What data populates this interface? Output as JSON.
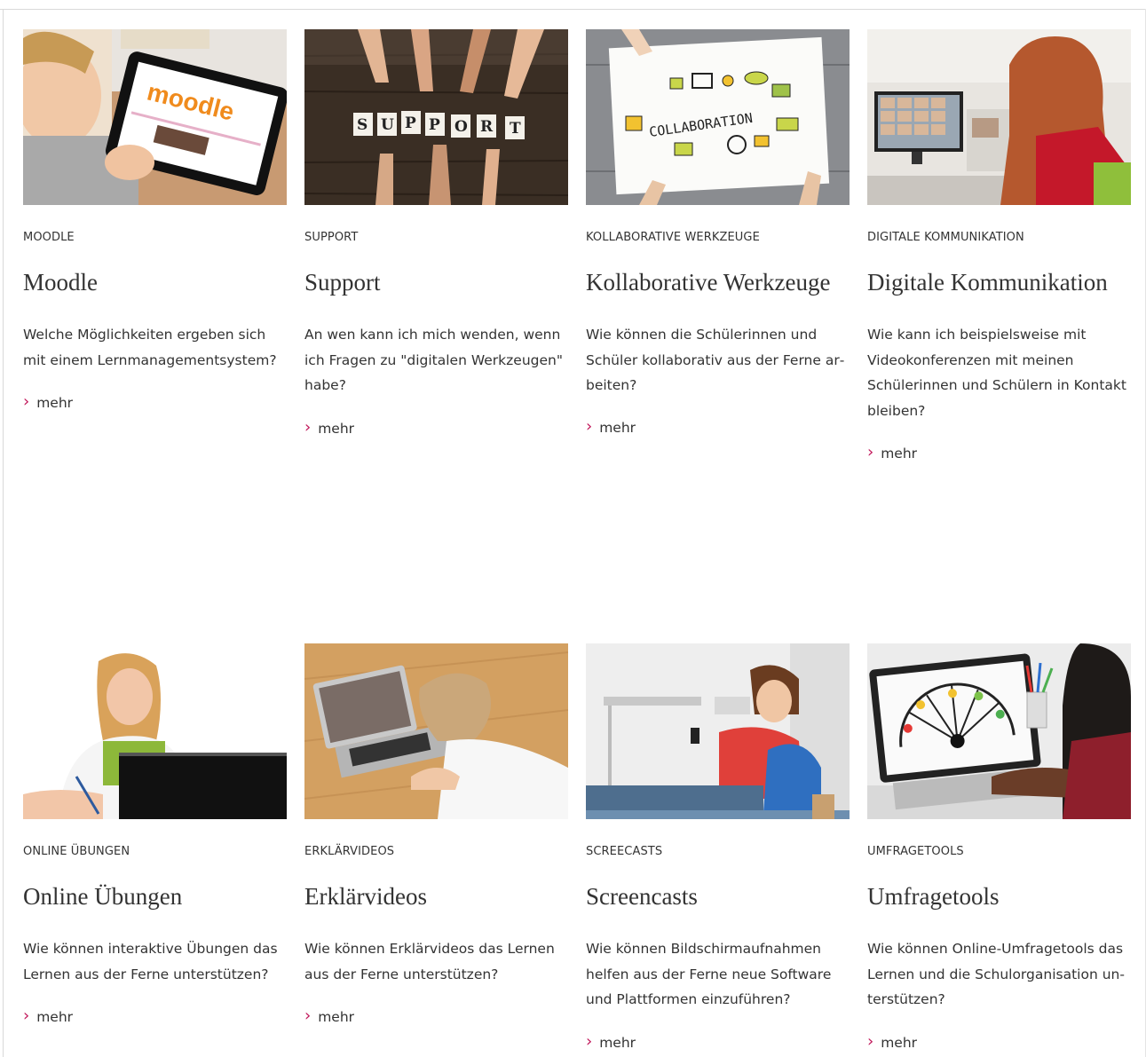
{
  "cards": [
    {
      "category": "MOODLE",
      "title": "Moodle",
      "description": "Welche Möglichkeiten ergeben sich mit einem Lernmanagementsystem?",
      "more": "mehr",
      "image_text": "moodle"
    },
    {
      "category": "SUPPORT",
      "title": "Support",
      "description": "An wen kann ich mich wenden, wenn ich Fragen zu \"digitalen Werkzeugen\" habe?",
      "more": "mehr",
      "image_text": "SUPPORT"
    },
    {
      "category": "KOLLABORATIVE WERKZEUGE",
      "title": "Kollaborative Werkzeuge",
      "description": "Wie können die Schülerinnen und Schüler kollaborativ aus der Ferne ar­beiten?",
      "more": "mehr",
      "image_text": "COLLABORATION"
    },
    {
      "category": "DIGITALE KOMMUNIKATION",
      "title": "Digitale Kommunikation",
      "description": "Wie kann ich beispielsweise mit Videokonferenzen mit meinen Schülerinnen und Schülern in Kontakt bleiben?",
      "more": "mehr"
    },
    {
      "category": "ONLINE ÜBUNGEN",
      "title": "Online Übungen",
      "description": "Wie können interaktive Übungen das Lernen aus der Ferne unterstützen?",
      "more": "mehr"
    },
    {
      "category": "ERKLÄRVIDEOS",
      "title": "Erklärvideos",
      "description": "Wie können Erklärvideos das Lernen aus der Ferne unterstützen?",
      "more": "mehr"
    },
    {
      "category": "SCREECASTS",
      "title": "Screencasts",
      "description": "Wie können Bildschirmaufnahmen helfen aus der Ferne neue Software und Plattformen einzuführen?",
      "more": "mehr"
    },
    {
      "category": "UMFRAGETOOLS",
      "title": "Umfragetools",
      "description": "Wie können Online-Umfragetools das Lernen und die Schulorganisation un­terstützen?",
      "more": "mehr"
    }
  ],
  "colors": {
    "accent": "#c2185b",
    "text": "#333333"
  },
  "icons": {
    "more": "chevron-right-icon"
  }
}
